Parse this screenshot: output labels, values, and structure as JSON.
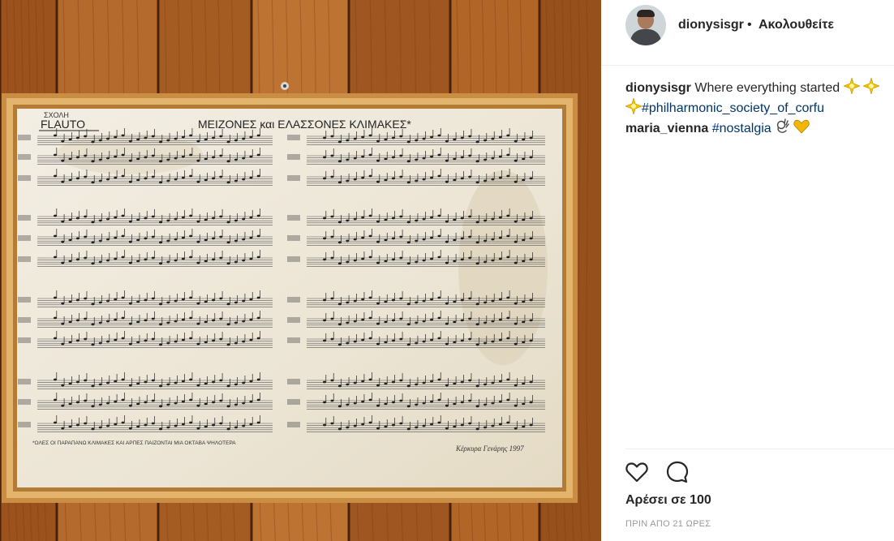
{
  "post": {
    "photo_alt": "Framed handwritten flute scales sheet on wooden wall",
    "sheet": {
      "header_small": "ΣΧΟΛΗ",
      "instrument": "FLAUTO",
      "title": "ΜΕΙΖΟΝΕΣ και ΕΛΑΣΣΟΝΕΣ ΚΛΙΜΑΚΕΣ*",
      "footnote": "*ΟΛΕΣ ΟΙ ΠΑΡΑΠΑΝΩ ΚΛΙΜΑΚΕΣ ΚΑΙ ΑΡΠΕΣ ΠΑΙΖΟΝΤΑΙ ΜΙΑ ΟΚΤΑΒΑ ΨΗΛΟΤΕΡΑ",
      "signature": "Κέρκυρα Γενάρης 1997"
    }
  },
  "header": {
    "username": "dionysisgr",
    "separator": "•",
    "follow_status": "Ακολουθείτε",
    "avatar_icon": "profile-avatar"
  },
  "comments": [
    {
      "user": "dionysisgr",
      "text": "Where everything started",
      "hashtag": "#philharmonic_society_of_corfu"
    },
    {
      "user": "maria_vienna",
      "hashtag": "#nostalgia"
    }
  ],
  "actions": {
    "like_icon": "heart-outline-icon",
    "comment_icon": "speech-bubble-icon",
    "likes_text": "Αρέσει σε 100",
    "timestamp": "ΠΡΙΝ ΑΠΟ 21 ΩΡΕΣ"
  },
  "colors": {
    "hashtag": "#003569",
    "text": "#262626",
    "muted": "#999999",
    "wood": "#a45a22",
    "frame": "#d7a55a",
    "paper": "#efe9dc"
  }
}
